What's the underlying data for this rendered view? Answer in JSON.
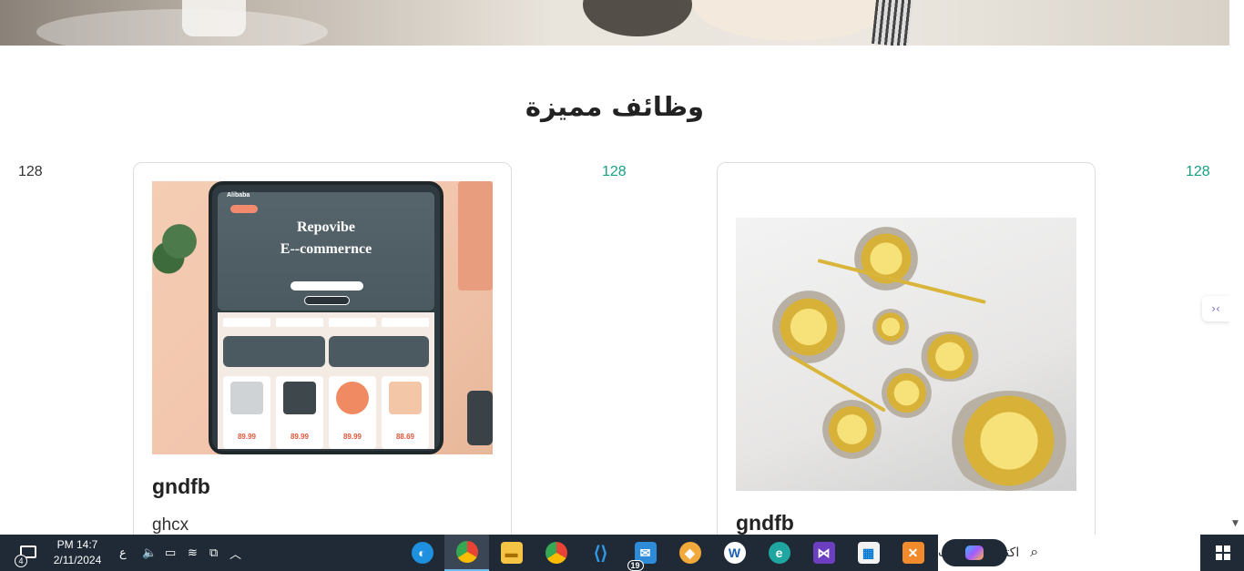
{
  "section": {
    "title": "وظائف مميزة"
  },
  "counters": {
    "left": "128",
    "middle": "128",
    "right": "128"
  },
  "cards": [
    {
      "title": "gndfb",
      "description": "ghcx",
      "image": {
        "brand": "Alibaba",
        "headline1": "Repovibe",
        "headline2": "E--commernce",
        "prices": [
          "89.99",
          "89.99",
          "89.99",
          "88.69"
        ]
      }
    },
    {
      "title": "gndfb"
    }
  ],
  "side_widget": {
    "label": "›‹"
  },
  "taskbar": {
    "search_placeholder": "اكتب هنا للبحث",
    "clock_time": "PM 14:7",
    "clock_date": "2/11/2024",
    "language": "ع",
    "notification_count": "4",
    "mail_badge": "19",
    "apps": [
      "copilot-icon",
      "microsoft-store-icon",
      "visual-studio-icon",
      "edge-icon",
      "mail-icon",
      "chrome-icon",
      "vscode-icon",
      "file-explorer-icon",
      "chrome-profile-icon",
      "edge-dev-icon"
    ]
  },
  "colors": {
    "accent": "#17a085",
    "taskbar": "#1f2a36"
  }
}
